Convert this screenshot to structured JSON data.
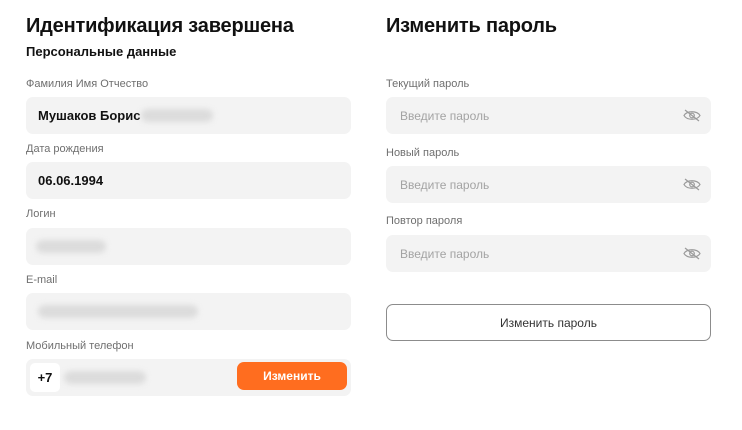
{
  "identification": {
    "title": "Идентификация завершена",
    "subtitle": "Персональные данные",
    "full_name": {
      "label": "Фамилия Имя Отчество",
      "value": "Мушаков Борис"
    },
    "birth_date": {
      "label": "Дата рождения",
      "value": "06.06.1994"
    },
    "login": {
      "label": "Логин"
    },
    "email": {
      "label": "E-mail"
    },
    "phone": {
      "label": "Мобильный телефон",
      "prefix": "+7",
      "change_label": "Изменить"
    }
  },
  "password": {
    "title": "Изменить пароль",
    "current": {
      "label": "Текущий пароль",
      "placeholder": "Введите пароль"
    },
    "new": {
      "label": "Новый пароль",
      "placeholder": "Введите пароль"
    },
    "repeat": {
      "label": "Повтор пароля",
      "placeholder": "Введите пароль"
    },
    "submit_label": "Изменить пароль"
  },
  "icons": {
    "toggle_visibility": "eye-off-icon"
  },
  "colors": {
    "accent": "#ff6d1f",
    "field_bg": "#f3f3f3"
  }
}
